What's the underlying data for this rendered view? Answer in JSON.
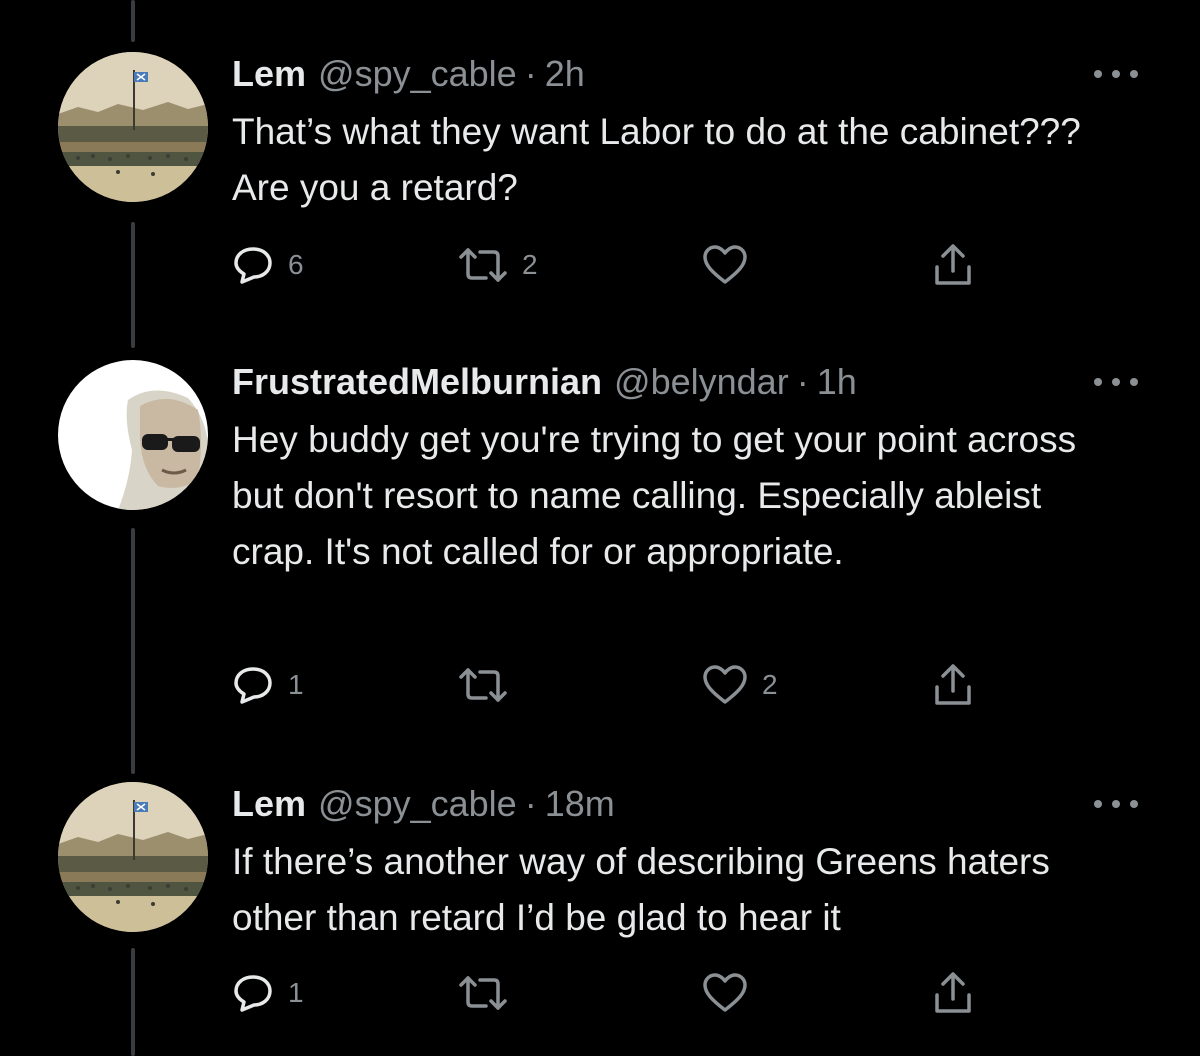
{
  "tweets": [
    {
      "author": "Lem",
      "handle": "@spy_cable",
      "separator": "·",
      "time": "2h",
      "text": "That’s what they want Labor to do at the cabinet??? Are you a retard?",
      "avatar_icon": "protest-crowd-painting-avatar",
      "replies": "6",
      "retweets": "2",
      "likes": "",
      "share": ""
    },
    {
      "author": "FrustratedMelburnian",
      "handle": "@belyndar",
      "separator": "·",
      "time": "1h",
      "text": "Hey buddy get you're trying to get your point across but don't resort to name calling. Especially ableist crap. It's not called for or appropriate.",
      "avatar_icon": "person-sunglasses-avatar",
      "replies": "1",
      "retweets": "",
      "likes": "2",
      "share": ""
    },
    {
      "author": "Lem",
      "handle": "@spy_cable",
      "separator": "·",
      "time": "18m",
      "text": "If there’s another way of describing Greens haters other than retard I’d be glad to hear it",
      "avatar_icon": "protest-crowd-painting-avatar",
      "replies": "1",
      "retweets": "",
      "likes": "",
      "share": ""
    }
  ],
  "icons": {
    "reply": "reply-icon",
    "retweet": "retweet-icon",
    "like": "heart-icon",
    "share": "share-icon",
    "more": "more-options-icon"
  },
  "colors": {
    "background": "#000000",
    "text": "#e7e9ea",
    "secondary": "#8b9095",
    "thread_line": "#3a3d40"
  }
}
